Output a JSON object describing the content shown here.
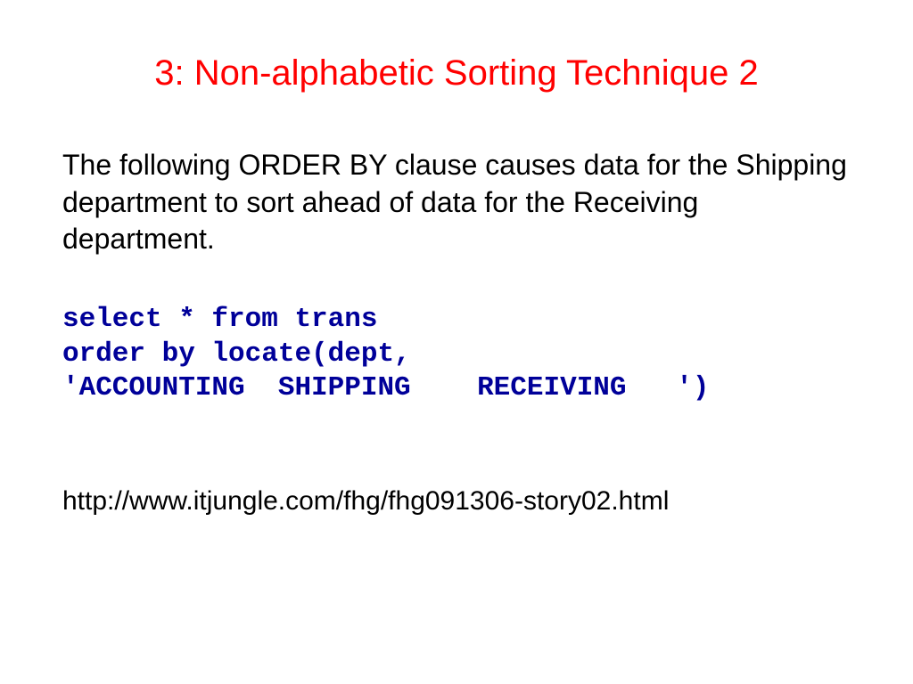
{
  "slide": {
    "title": "3: Non-alphabetic Sorting Technique 2",
    "body": "The following ORDER BY clause causes data for the Shipping department to sort ahead of data for the Receiving department.",
    "code": "select * from trans\norder by locate(dept,\n'ACCOUNTING  SHIPPING    RECEIVING   ')",
    "link": "http://www.itjungle.com/fhg/fhg091306-story02.html"
  }
}
